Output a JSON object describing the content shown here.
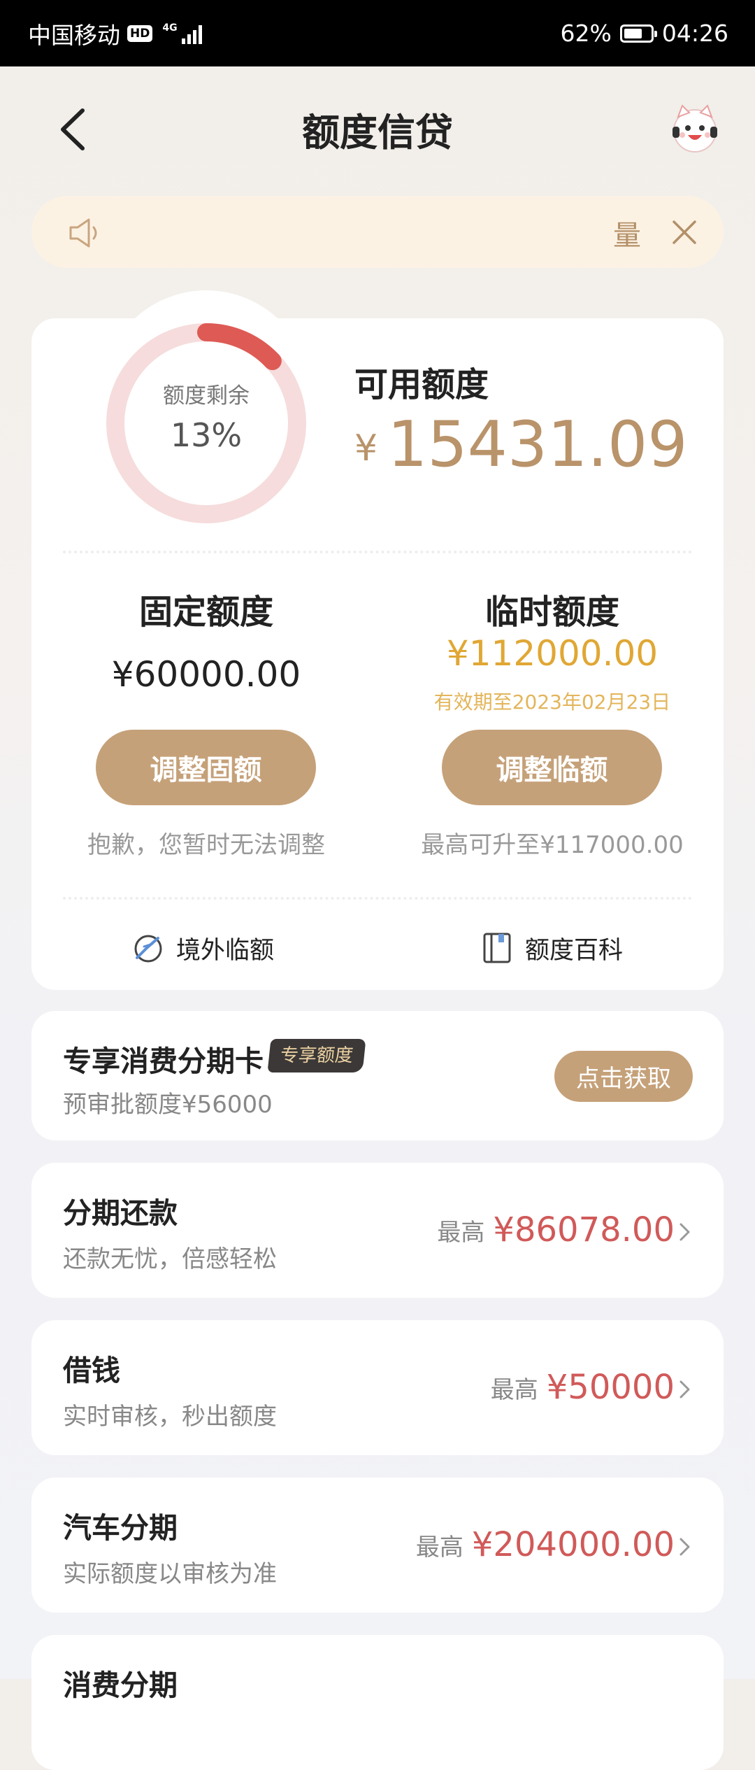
{
  "status_bar": {
    "carrier": "中国移动",
    "hd": "HD",
    "network": "4G",
    "battery": "62%",
    "time": "04:26"
  },
  "header": {
    "title": "额度信贷"
  },
  "notice": {
    "text": "量"
  },
  "quota": {
    "ring_label": "额度剩余",
    "ring_value": "13%",
    "ring_fraction": 0.13,
    "available_label": "可用额度",
    "currency": "¥",
    "available_amount": "15431.09",
    "fixed": {
      "title": "固定额度",
      "amount": "¥60000.00",
      "button": "调整固额",
      "note": "抱歉，您暂时无法调整"
    },
    "temporary": {
      "title": "临时额度",
      "amount": "¥112000.00",
      "valid_until": "有效期至2023年02月23日",
      "button": "调整临额",
      "note": "最高可升至¥117000.00"
    },
    "links": {
      "overseas": "境外临额",
      "wiki": "额度百科"
    }
  },
  "promo": {
    "title": "专享消费分期卡",
    "badge": "专享额度",
    "subtitle": "预审批额度¥56000",
    "button": "点击获取"
  },
  "products": [
    {
      "title": "分期还款",
      "subtitle": "还款无忧，倍感轻松",
      "max_label": "最高",
      "amount": "¥86078.00"
    },
    {
      "title": "借钱",
      "subtitle": "实时审核，秒出额度",
      "max_label": "最高",
      "amount": "¥50000"
    },
    {
      "title": "汽车分期",
      "subtitle": "实际额度以审核为准",
      "max_label": "最高",
      "amount": "¥204000.00"
    },
    {
      "title": "消费分期"
    }
  ],
  "colors": {
    "gold": "#c5a179",
    "amount_gold": "#b9936a",
    "temp_amount": "#e0a734",
    "red_amount": "#d05a59",
    "ring_track": "#f6dcdc",
    "ring_progress": "#de5a55"
  }
}
